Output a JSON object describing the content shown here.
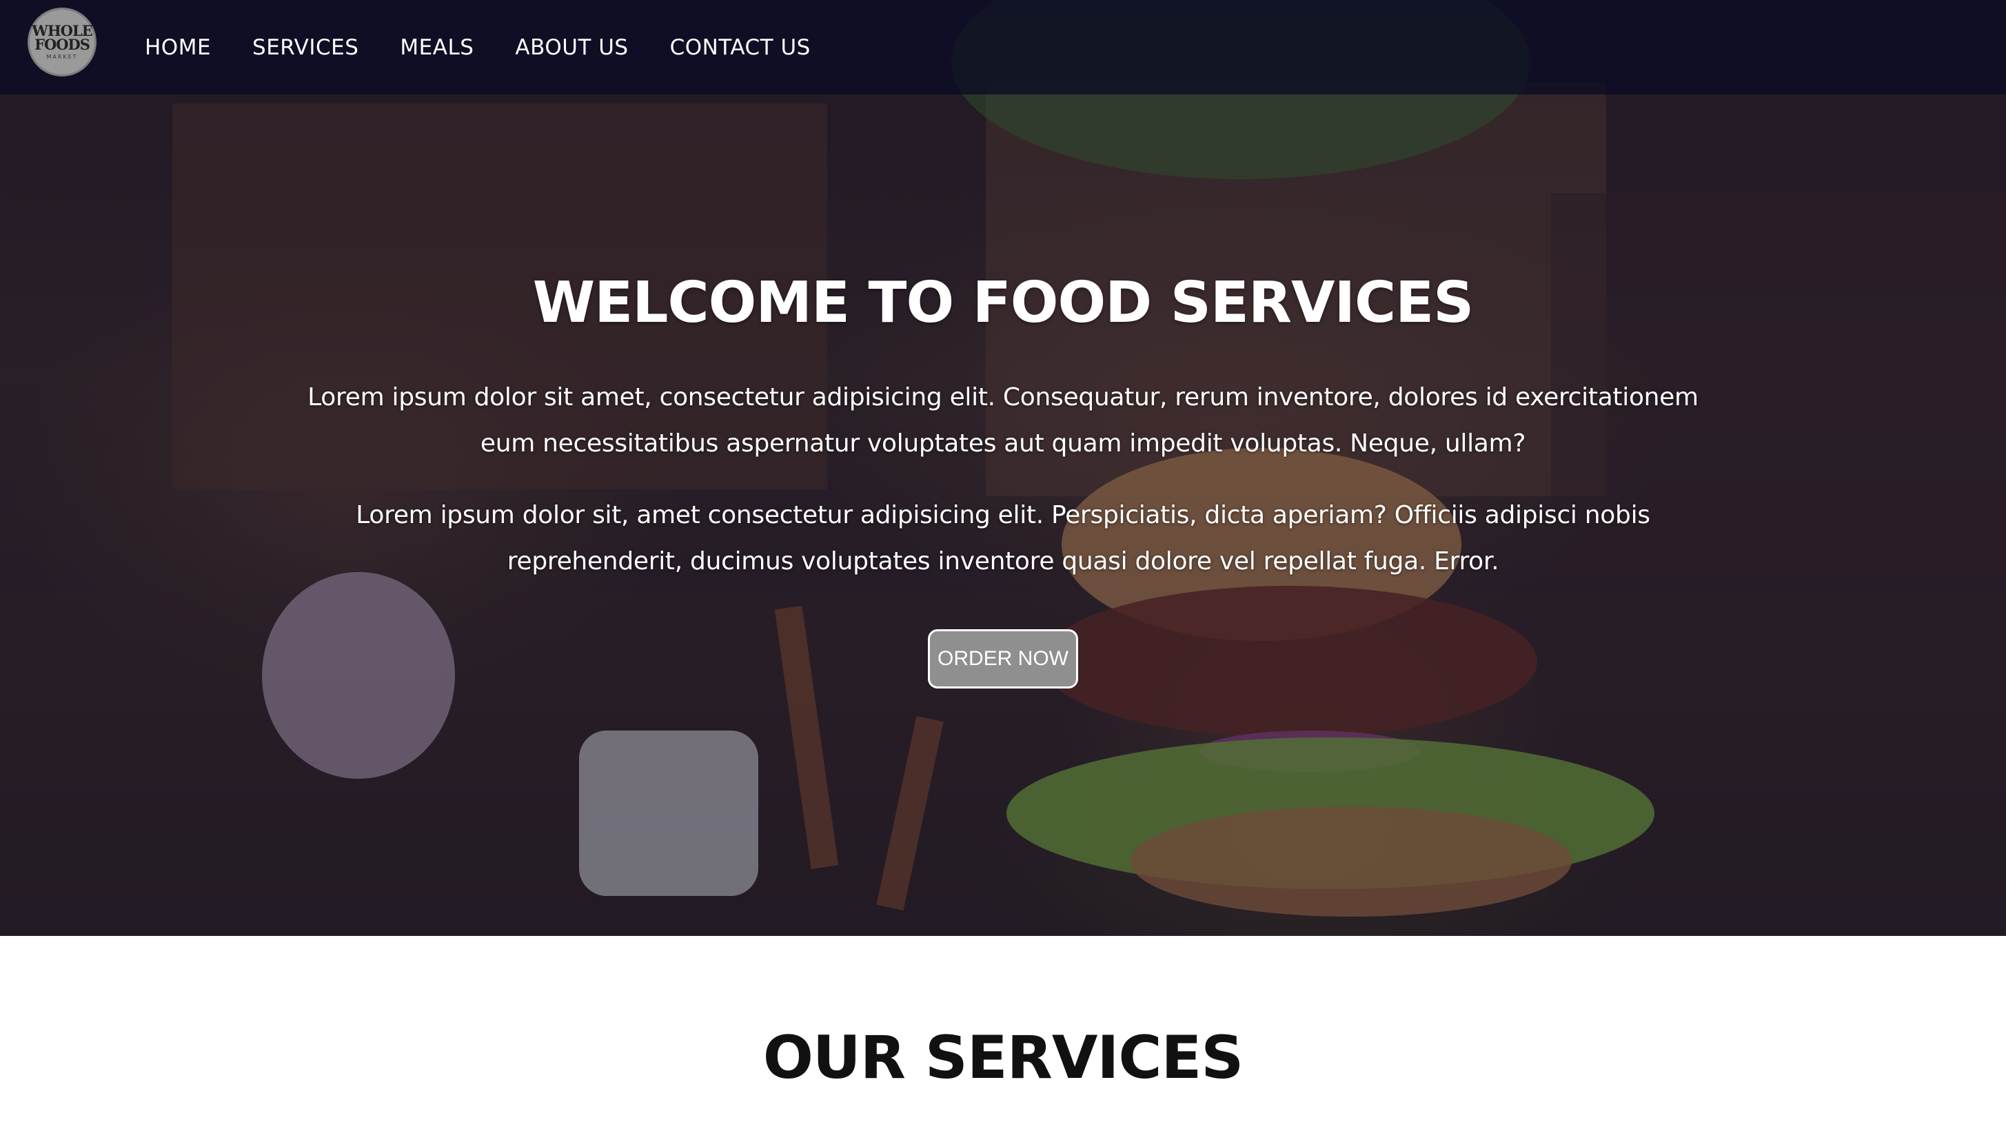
{
  "brand": {
    "logo_line1": "WHOLE",
    "logo_line2": "FOODS",
    "logo_line3": "MARKET"
  },
  "nav": {
    "items": [
      "HOME",
      "SERVICES",
      "MEALS",
      "ABOUT US",
      "CONTACT US"
    ]
  },
  "hero": {
    "title": "WELCOME TO FOOD SERVICES",
    "paragraph1": "Lorem ipsum dolor sit amet, consectetur adipisicing elit. Consequatur, rerum inventore, dolores id exercitationem eum necessitatibus aspernatur voluptates aut quam impedit voluptas. Neque, ullam?",
    "paragraph2": "Lorem ipsum dolor sit, amet consectetur adipisicing elit. Perspiciatis, dicta aperiam? Officiis adipisci nobis reprehenderit, ducimus voluptates inventore quasi dolore vel repellat fuga. Error.",
    "cta_label": "ORDER NOW"
  },
  "services": {
    "title": "OUR SERVICES"
  },
  "colors": {
    "nav_bg": "#0c0c24",
    "button_bg": "#8f8f90",
    "text_light": "#ffffff",
    "heading_dark": "#111111"
  }
}
